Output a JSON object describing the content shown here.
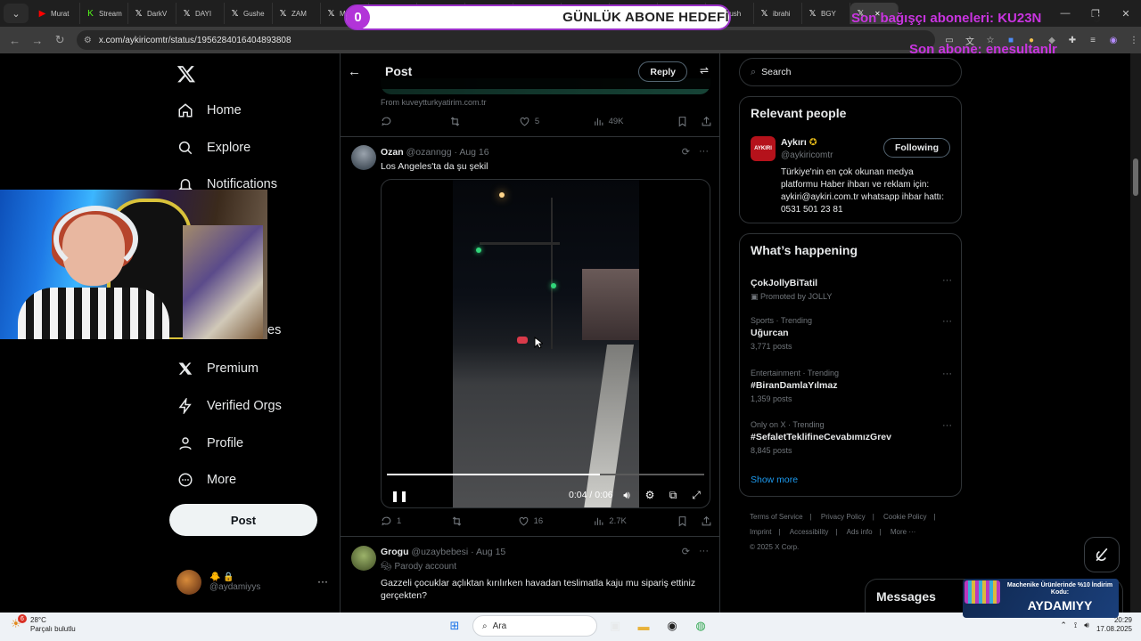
{
  "browser": {
    "tabs": [
      {
        "label": "Murat",
        "icon": "youtube-icon",
        "color": "#ff0000"
      },
      {
        "label": "Stream",
        "icon": "kick-icon",
        "color": "#53fc18"
      },
      {
        "label": "DarkV",
        "icon": "x-icon",
        "color": "#ffffff"
      },
      {
        "label": "DAYI",
        "icon": "x-icon",
        "color": "#ffffff"
      },
      {
        "label": "Gushe",
        "icon": "x-icon",
        "color": "#ffffff"
      },
      {
        "label": "ZAM",
        "icon": "x-icon",
        "color": "#ffffff"
      },
      {
        "label": "M",
        "icon": "x-icon",
        "color": "#ffffff"
      },
      {
        "label": "Boşun",
        "icon": "x-icon",
        "color": "#ffffff"
      },
      {
        "label": "ZAM",
        "icon": "x-icon",
        "color": "#ffffff"
      },
      {
        "label": "ZAM",
        "icon": "x-icon",
        "color": "#ffffff"
      },
      {
        "label": "Popul",
        "icon": "x-icon",
        "color": "#ffffff"
      },
      {
        "label": "Aykırı",
        "icon": "x-icon",
        "color": "#ffffff"
      },
      {
        "label": "ZAM",
        "icon": "x-icon",
        "color": "#ffffff"
      },
      {
        "label": "ibrahi",
        "icon": "x-icon",
        "color": "#ffffff"
      },
      {
        "label": "Push",
        "icon": "x-icon",
        "color": "#ffffff"
      },
      {
        "label": "ibrahi",
        "icon": "x-icon",
        "color": "#ffffff"
      },
      {
        "label": "BGY",
        "icon": "x-icon",
        "color": "#ffffff"
      },
      {
        "label": "",
        "icon": "x-icon",
        "color": "#ffffff",
        "active": true
      }
    ],
    "url": "x.com/aykiricomtr/status/1956284016404893808"
  },
  "overlay": {
    "goal_left": "0",
    "goal_title": "GÜNLÜK ABONE HEDEFİ",
    "goal_right": "5",
    "donor_text": "Son bağışçı aboneleri: KU23N",
    "subscriber_text": "Son abone: enesultanlr"
  },
  "nav": {
    "items": [
      {
        "label": "Home",
        "icon": "home-icon"
      },
      {
        "label": "Explore",
        "icon": "search-icon"
      },
      {
        "label": "Notifications",
        "icon": "bell-icon"
      },
      {
        "label": "es",
        "icon": ""
      },
      {
        "label": "Premium",
        "icon": "x-icon"
      },
      {
        "label": "Verified Orgs",
        "icon": "lightning-icon"
      },
      {
        "label": "Profile",
        "icon": "person-icon"
      },
      {
        "label": "More",
        "icon": "more-circle-icon"
      }
    ],
    "post_label": "Post",
    "account_handle": "@aydamiyys"
  },
  "thread": {
    "header_title": "Post",
    "reply_label": "Reply",
    "prev_source": "From kuveytturkyatirim.com.tr",
    "prev_actions": {
      "replies": "",
      "reposts": "",
      "likes": "5",
      "views": "49K"
    },
    "tweet1": {
      "name": "Ozan",
      "handle": "@ozanngg",
      "date": "Aug 16",
      "text": "Los Angeles'ta da şu şekil",
      "video_time": "0:04 / 0:06",
      "video_progress": 0.67,
      "actions": {
        "replies": "1",
        "reposts": "",
        "likes": "16",
        "views": "2.7K"
      }
    },
    "tweet2": {
      "name": "Grogu",
      "handle": "@uzaybebesi",
      "date": "Aug 15",
      "badge": "Parody account",
      "text": "Gazzeli çocuklar açlıktan kırılırken havadan teslimatla kaju mu sipariş ettiniz gerçekten?"
    }
  },
  "sidebar": {
    "search_placeholder": "Search",
    "relevant_title": "Relevant people",
    "person": {
      "name": "Aykırı",
      "handle": "@aykiricomtr",
      "avatar_text": "AYKIRI",
      "bio": "Türkiye'nin en çok okunan medya platformu Haber ihbarı ve reklam için: aykiri@aykiri.com.tr whatsapp ihbar hattı: 0531 501 23 81",
      "follow_label": "Following"
    },
    "happening_title": "What’s happening",
    "trends": [
      {
        "context": "",
        "name": "ÇokJollyBiTatil",
        "count": "Promoted by JOLLY"
      },
      {
        "context": "Sports · Trending",
        "name": "Uğurcan",
        "count": "3,771 posts"
      },
      {
        "context": "Entertainment · Trending",
        "name": "#BiranDamlaYılmaz",
        "count": "1,359 posts"
      },
      {
        "context": "Only on X · Trending",
        "name": "#SefaletTeklifineCevabımızGrev",
        "count": "8,845 posts"
      }
    ],
    "show_more": "Show more",
    "footer": [
      "Terms of Service",
      "Privacy Policy",
      "Cookie Policy",
      "Imprint",
      "Accessibility",
      "Ads info",
      "More ···",
      "© 2025 X Corp."
    ]
  },
  "messages_label": "Messages",
  "promo": {
    "text": "Machenike Ürünlerinde %10 İndirim Kodu:",
    "name": "AYDAMIYY"
  },
  "taskbar": {
    "temp": "28°C",
    "weather": "Parçalı bulutlu",
    "badge": "6",
    "search": "Ara",
    "time": "20:29",
    "date": "17.08.2025"
  },
  "colors": {
    "accent_blue": "#1d9bf0",
    "overlay_purple": "#c934e0",
    "muted": "#71767b",
    "border": "#2f3336"
  }
}
